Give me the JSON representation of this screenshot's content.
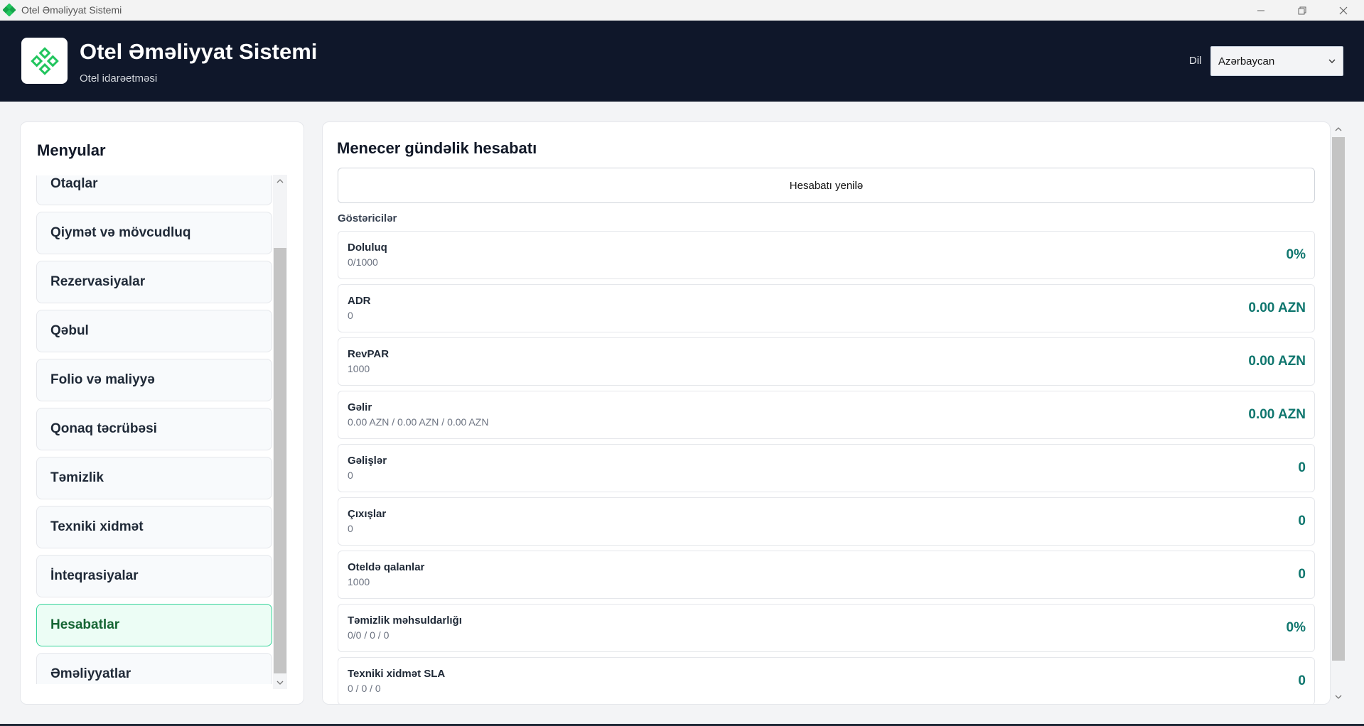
{
  "window": {
    "title": "Otel Əməliyyat Sistemi",
    "icon": "diamond-logo-icon"
  },
  "header": {
    "title": "Otel Əməliyyat Sistemi",
    "subtitle": "Otel idarəetməsi",
    "language_label": "Dil",
    "language_value": "Azərbaycan",
    "brand_color": "#22c55e"
  },
  "sidebar": {
    "title": "Menyular",
    "items": [
      {
        "label": "Otaqlar"
      },
      {
        "label": "Qiymət və mövcudluq"
      },
      {
        "label": "Rezervasiyalar"
      },
      {
        "label": "Qəbul"
      },
      {
        "label": "Folio və maliyyə"
      },
      {
        "label": "Qonaq təcrübəsi"
      },
      {
        "label": "Təmizlik"
      },
      {
        "label": "Texniki xidmət"
      },
      {
        "label": "İnteqrasiyalar"
      },
      {
        "label": "Hesabatlar",
        "active": true
      },
      {
        "label": "Əməliyyatlar"
      }
    ]
  },
  "main": {
    "title": "Menecer gündəlik hesabatı",
    "refresh_label": "Hesabatı yenilə",
    "section_label": "Göstəricilər",
    "metrics": [
      {
        "name": "Doluluq",
        "detail": "0/1000",
        "value": "0%"
      },
      {
        "name": "ADR",
        "detail": "0",
        "value": "0.00 AZN"
      },
      {
        "name": "RevPAR",
        "detail": "1000",
        "value": "0.00 AZN"
      },
      {
        "name": "Gəlir",
        "detail": "0.00 AZN / 0.00 AZN / 0.00 AZN",
        "value": "0.00 AZN"
      },
      {
        "name": "Gəlişlər",
        "detail": "0",
        "value": "0"
      },
      {
        "name": "Çıxışlar",
        "detail": "0",
        "value": "0"
      },
      {
        "name": "Oteldə qalanlar",
        "detail": "1000",
        "value": "0"
      },
      {
        "name": "Təmizlik məhsuldarlığı",
        "detail": "0/0 / 0 / 0",
        "value": "0%"
      },
      {
        "name": "Texniki xidmət SLA",
        "detail": "0 / 0 / 0",
        "value": "0"
      }
    ]
  },
  "colors": {
    "header_bg": "#0f172a",
    "accent_value": "#0f766e",
    "active_bg": "#ecfdf5",
    "active_border": "#34d399"
  }
}
